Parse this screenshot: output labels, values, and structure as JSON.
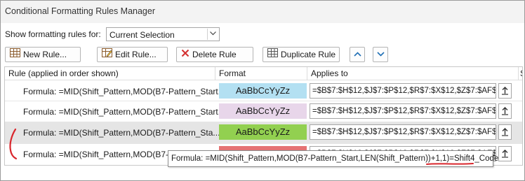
{
  "window": {
    "title": "Conditional Formatting Rules Manager"
  },
  "show_rules": {
    "label": "Show formatting rules for:",
    "selected": "Current Selection"
  },
  "toolbar": {
    "new_rule": "New Rule...",
    "edit_rule": "Edit Rule...",
    "delete_rule": "Delete Rule",
    "duplicate_rule": "Duplicate Rule"
  },
  "columns": {
    "rule": "Rule (applied in order shown)",
    "format": "Format",
    "applies_to": "Applies to",
    "stop_if_true": "S"
  },
  "rules": [
    {
      "formula": "Formula: =MID(Shift_Pattern,MOD(B7-Pattern_Start...",
      "format_preview": "AaBbCcYyZz",
      "format_color": "#b3e0f2",
      "applies_to": "=$B$7:$H$12,$J$7:$P$12,$R$7:$X$12,$Z$7:$AF$12,$"
    },
    {
      "formula": "Formula: =MID(Shift_Pattern,MOD(B7-Pattern_Start...",
      "format_preview": "AaBbCcYyZz",
      "format_color": "#e8d6ea",
      "applies_to": "=$B$7:$H$12,$J$7:$P$12,$R$7:$X$12,$Z$7:$AF$12,$"
    },
    {
      "formula": "Formula: =MID(Shift_Pattern,MOD(B7-Pattern_Sta...",
      "format_preview": "AaBbCcYyZz",
      "format_color": "#92d050",
      "applies_to": "=$B$7:$H$12,$J$7:$P$12,$R$7:$X$12,$Z$7:$AF$12,$"
    },
    {
      "formula": "Formula: =MID(Shift_Pattern,MOD(B7-Pattern_Sta...",
      "format_preview": "",
      "format_color": "#e57373",
      "applies_to": "=$B$7:$H$12,$J$7:$P$12,$R$7:$X$12,$Z$7:$AF$12,$"
    }
  ],
  "tooltip": {
    "prefix": "Formula: =MID(Shift_Pattern,MOD(B7-Pattern_Start,LEN(Shift_Pattern))+1,1)=",
    "highlight": "Shift4_Code"
  },
  "annotation_color": "#d9262c"
}
